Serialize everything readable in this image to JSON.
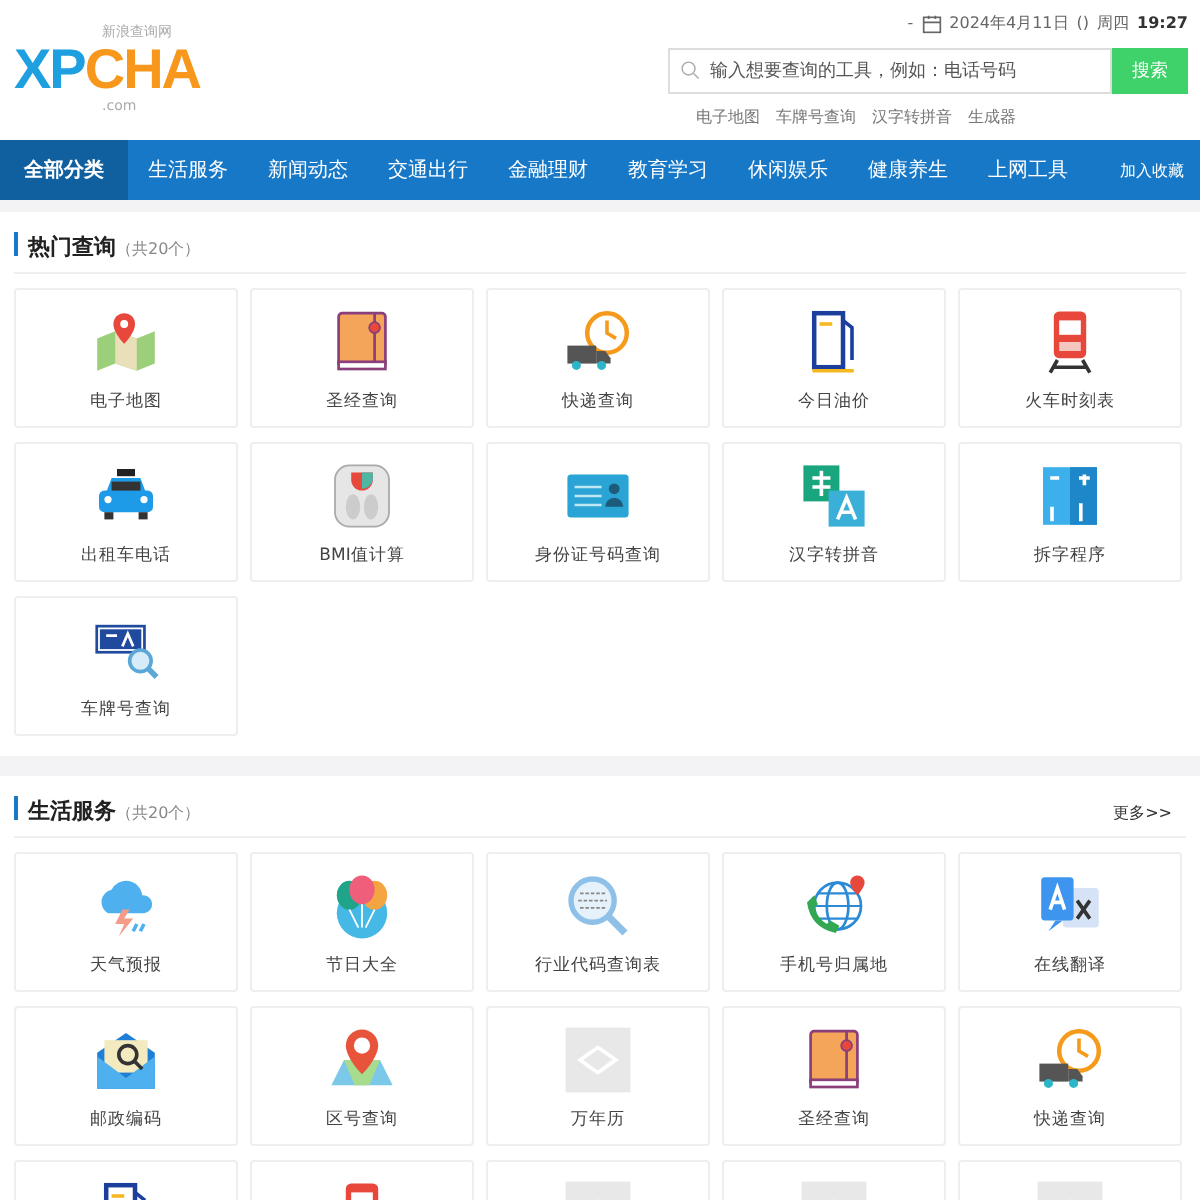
{
  "logo": {
    "part_1": "XP",
    "part_2": "CHA",
    "subtitle": "新浪查询网",
    "domain": ".com"
  },
  "top_bar": {
    "dash": "-",
    "date": "2024年4月11日",
    "parens": "()",
    "weekday": "周四",
    "time": "19:27"
  },
  "search": {
    "placeholder": "输入想要查询的工具，例如：电话号码",
    "button": "搜索",
    "hot_links": [
      "电子地图",
      "车牌号查询",
      "汉字转拼音",
      "生成器"
    ]
  },
  "nav": {
    "items": [
      {
        "label": "全部分类",
        "selected": true
      },
      {
        "label": "生活服务",
        "selected": false
      },
      {
        "label": "新闻动态",
        "selected": false
      },
      {
        "label": "交通出行",
        "selected": false
      },
      {
        "label": "金融理财",
        "selected": false
      },
      {
        "label": "教育学习",
        "selected": false
      },
      {
        "label": "休闲娱乐",
        "selected": false
      },
      {
        "label": "健康养生",
        "selected": false
      },
      {
        "label": "上网工具",
        "selected": false
      }
    ],
    "bookmark": "加入收藏"
  },
  "sections": [
    {
      "title": "热门查询",
      "count": "（共20个）",
      "tiles": [
        {
          "label": "电子地图",
          "kind": "map"
        },
        {
          "label": "圣经查询",
          "kind": "book"
        },
        {
          "label": "快递查询",
          "kind": "delivery"
        },
        {
          "label": "今日油价",
          "kind": "fuel"
        },
        {
          "label": "火车时刻表",
          "kind": "train"
        },
        {
          "label": "出租车电话",
          "kind": "taxi"
        },
        {
          "label": "BMI值计算",
          "kind": "scale"
        },
        {
          "label": "身份证号码查询",
          "kind": "idcard"
        },
        {
          "label": "汉字转拼音",
          "kind": "pinyin"
        },
        {
          "label": "拆字程序",
          "kind": "split"
        },
        {
          "label": "车牌号查询",
          "kind": "plate"
        }
      ]
    },
    {
      "title": "生活服务",
      "count": "（共20个）",
      "more": "更多>>",
      "tiles": [
        {
          "label": "天气预报",
          "kind": "weather"
        },
        {
          "label": "节日大全",
          "kind": "balloons"
        },
        {
          "label": "行业代码查询表",
          "kind": "codesearch"
        },
        {
          "label": "手机号归属地",
          "kind": "phoneglobe"
        },
        {
          "label": "在线翻译",
          "kind": "translate"
        },
        {
          "label": "邮政编码",
          "kind": "mail"
        },
        {
          "label": "区号查询",
          "kind": "areapin"
        },
        {
          "label": "万年历",
          "kind": "placeholder"
        },
        {
          "label": "圣经查询",
          "kind": "book"
        },
        {
          "label": "快递查询",
          "kind": "delivery"
        },
        {
          "kind": "fuel"
        },
        {
          "kind": "train"
        },
        {
          "kind": "placeholder"
        },
        {
          "kind": "placeholder"
        },
        {
          "kind": "placeholder"
        }
      ]
    }
  ]
}
